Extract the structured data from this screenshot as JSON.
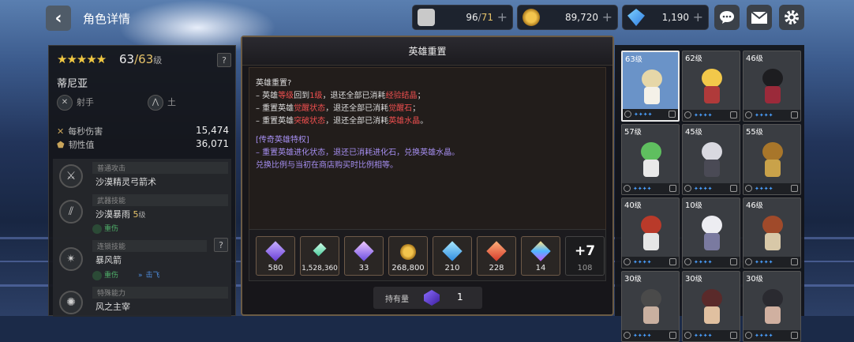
{
  "header": {
    "title": "角色详情"
  },
  "resources": {
    "stamina": {
      "value": "96",
      "max": "71"
    },
    "gold": "89,720",
    "gems": "1,190"
  },
  "hero": {
    "level": "63",
    "max_level": "63",
    "level_unit": "级",
    "name": "蒂尼亚",
    "class": "射手",
    "element": "土",
    "stats": [
      {
        "label": "每秒伤害",
        "value": "15,474"
      },
      {
        "label": "韧性值",
        "value": "36,071"
      }
    ],
    "skills": [
      {
        "category": "普通攻击",
        "name": "沙漠精灵弓箭术"
      },
      {
        "category": "武器技能",
        "name": "沙漠暴雨",
        "level": "5",
        "level_unit": "级",
        "tags": [
          "重伤"
        ]
      },
      {
        "category": "连锁技能",
        "name": "暴风箭",
        "tags": [
          "重伤",
          "击飞"
        ]
      },
      {
        "category": "特殊能力",
        "name": "风之主宰"
      }
    ]
  },
  "modal": {
    "title": "英雄重置",
    "question": "英雄重置?",
    "lines": [
      {
        "p1": "– 英雄",
        "r1": "等级",
        "p2": "回到",
        "r2": "1级",
        "p3": "，退还全部已消耗",
        "r3": "经验结晶",
        "p4": "；"
      },
      {
        "p1": "– 重置英雄",
        "r1": "觉醒状态",
        "p2": "，退还全部已消耗",
        "r2": "觉醒石",
        "p3": "；"
      },
      {
        "p1": "– 重置英雄",
        "r1": "突破状态",
        "p2": "，退还全部已消耗",
        "r2": "英雄水晶",
        "p3": "。"
      }
    ],
    "privilege_title": "[传奇英雄特权]",
    "privilege_lines": [
      "– 重置英雄进化状态，退还已消耗进化石，兑换英雄水晶。",
      "兑换比例与当初在商店购买时比例相等。"
    ],
    "items": [
      "580",
      "1,528,360",
      "33",
      "268,800",
      "210",
      "228",
      "14"
    ],
    "more": {
      "label": "+7",
      "count": "108"
    },
    "owned": {
      "label": "持有量",
      "value": "1"
    }
  },
  "roster": [
    {
      "level": "63",
      "unit": "级"
    },
    {
      "level": "62",
      "unit": "级"
    },
    {
      "level": "46",
      "unit": "级"
    },
    {
      "level": "57",
      "unit": "级"
    },
    {
      "level": "45",
      "unit": "级"
    },
    {
      "level": "55",
      "unit": "级"
    },
    {
      "level": "40",
      "unit": "级"
    },
    {
      "level": "10",
      "unit": "级"
    },
    {
      "level": "46",
      "unit": "级"
    },
    {
      "level": "30",
      "unit": "级"
    },
    {
      "level": "30",
      "unit": "级"
    },
    {
      "level": "30",
      "unit": "级"
    }
  ],
  "colors": {
    "accent_gold": "#e6c36a",
    "highlight_red": "#ef4f4f",
    "privilege_purple": "#a58ef0"
  }
}
